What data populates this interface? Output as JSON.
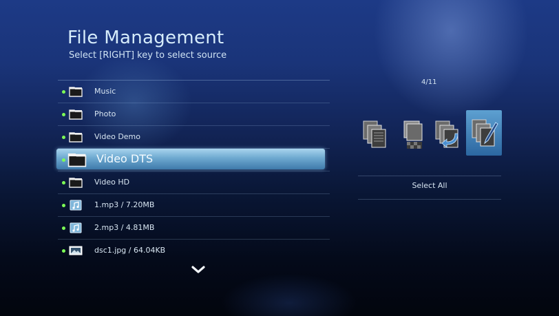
{
  "header": {
    "title": "File Management",
    "subtitle": "Select [RIGHT] key to select source"
  },
  "file_list": {
    "items": [
      {
        "label": "Music",
        "icon": "folder-icon",
        "selected": false
      },
      {
        "label": "Photo",
        "icon": "folder-icon",
        "selected": false
      },
      {
        "label": "Video Demo",
        "icon": "folder-icon",
        "selected": false
      },
      {
        "label": "Video DTS",
        "icon": "folder-icon",
        "selected": true
      },
      {
        "label": "Video HD",
        "icon": "folder-icon",
        "selected": false
      },
      {
        "label": "1.mp3 / 7.20MB",
        "icon": "music-file-icon",
        "selected": false
      },
      {
        "label": "2.mp3 / 4.81MB",
        "icon": "music-file-icon",
        "selected": false
      },
      {
        "label": "dsc1.jpg / 64.04KB",
        "icon": "image-file-icon",
        "selected": false
      }
    ],
    "more_indicator": "chevron-down-icon"
  },
  "right_panel": {
    "page_count": "4/11",
    "actions": [
      {
        "icon": "copy-icon",
        "active": false
      },
      {
        "icon": "delete-icon",
        "active": false
      },
      {
        "icon": "move-icon",
        "active": false
      },
      {
        "icon": "rename-icon",
        "active": true
      }
    ],
    "select_all_label": "Select All"
  },
  "colors": {
    "accent_highlight": "#6ea9d0",
    "bullet": "#7dff56",
    "text": "#d8e6f2"
  }
}
